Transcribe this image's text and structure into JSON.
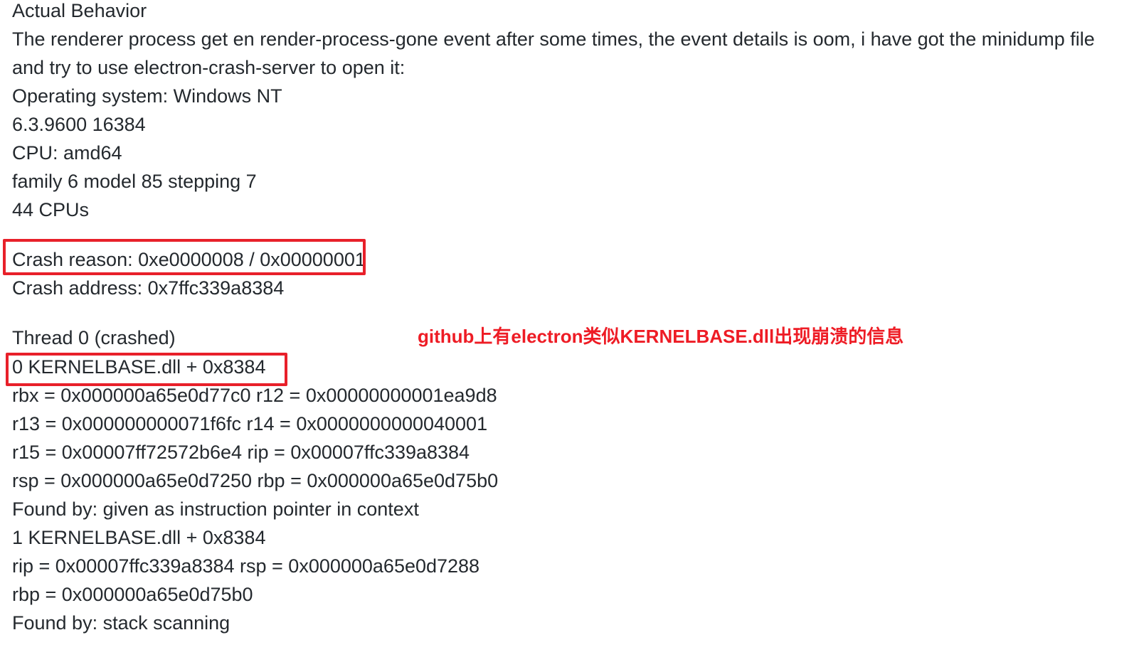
{
  "issue": {
    "heading": "Actual Behavior",
    "description_line1": "The renderer process get en render-process-gone event after some times, the event details is oom, i have got the minidump file",
    "description_line2": "and try to use electron-crash-server to open it:",
    "os_line": "Operating system: Windows NT",
    "os_version": "6.3.9600 16384",
    "cpu_line": "CPU: amd64",
    "cpu_family": "family 6 model 85 stepping 7",
    "cpu_count": "44 CPUs",
    "crash_reason": "Crash reason: 0xe0000008 / 0x00000001",
    "crash_address": "Crash address: 0x7ffc339a8384",
    "thread_header": "Thread 0 (crashed)",
    "frames": [
      {
        "title": "0 KERNELBASE.dll + 0x8384",
        "registers": [
          "rbx = 0x000000a65e0d77c0 r12 = 0x00000000001ea9d8",
          "r13 = 0x000000000071f6fc r14 = 0x0000000000040001",
          "r15 = 0x00007ff72572b6e4 rip = 0x00007ffc339a8384",
          "rsp = 0x000000a65e0d7250 rbp = 0x000000a65e0d75b0"
        ],
        "found_by": "Found by: given as instruction pointer in context"
      },
      {
        "title": "1 KERNELBASE.dll + 0x8384",
        "registers": [
          "rip = 0x00007ffc339a8384 rsp = 0x000000a65e0d7288",
          "rbp = 0x000000a65e0d75b0"
        ],
        "found_by": "Found by: stack scanning"
      }
    ]
  },
  "annotation": {
    "text": "github上有electron类似KERNELBASE.dll出现崩溃的信息",
    "color": "#ee1c25"
  },
  "highlight_color": "#e8202a"
}
